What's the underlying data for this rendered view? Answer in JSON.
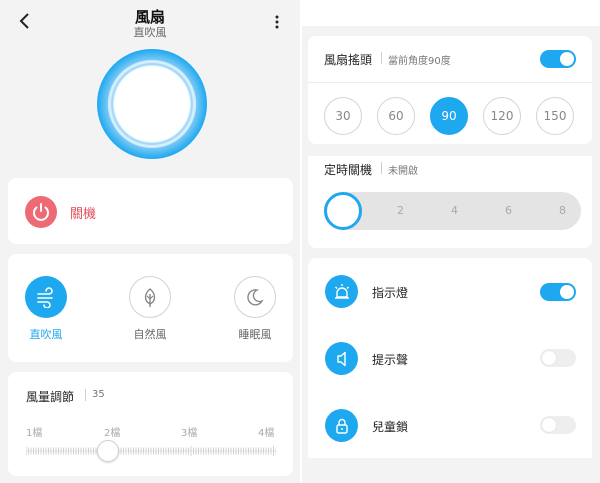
{
  "header": {
    "title": "風扇",
    "subtitle": "直吹風"
  },
  "power": {
    "label": "關機"
  },
  "modes": [
    {
      "label": "直吹風",
      "icon": "wind-icon",
      "active": true
    },
    {
      "label": "自然風",
      "icon": "leaf-icon",
      "active": false
    },
    {
      "label": "睡眠風",
      "icon": "moon-icon",
      "active": false
    }
  ],
  "speed": {
    "title": "風量調節",
    "value": "35",
    "gears": [
      "1檔",
      "2檔",
      "3檔",
      "4檔"
    ]
  },
  "swing": {
    "title": "風扇搖頭",
    "status": "當前角度90度",
    "enabled": true,
    "angles": [
      "30",
      "60",
      "90",
      "120",
      "150"
    ],
    "selected": "90"
  },
  "timer": {
    "title": "定時關機",
    "status": "未開啟",
    "labels": [
      "2",
      "4",
      "6",
      "8"
    ]
  },
  "settings": [
    {
      "label": "指示燈",
      "icon": "light-icon",
      "enabled": true
    },
    {
      "label": "提示聲",
      "icon": "speaker-icon",
      "enabled": false
    },
    {
      "label": "兒童鎖",
      "icon": "lock-icon",
      "enabled": false
    }
  ],
  "colors": {
    "accent": "#1da8f0",
    "power": "#ee6a74",
    "background": "#f3f3f3"
  }
}
